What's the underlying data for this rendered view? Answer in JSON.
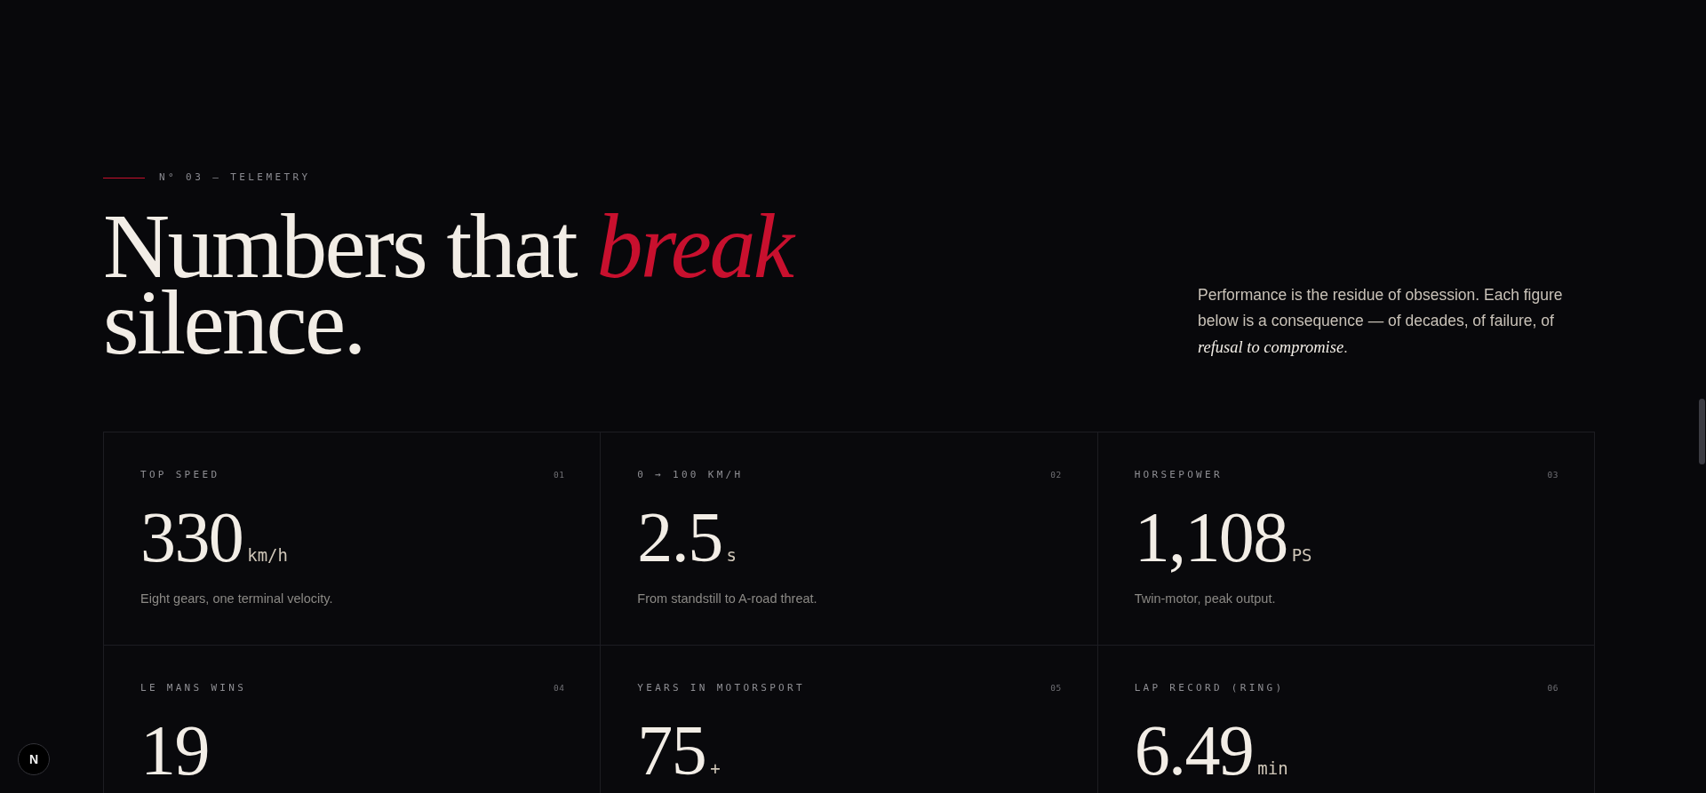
{
  "section": {
    "eyebrow": "N° 03 — TELEMETRY",
    "heading": "Numbers that *break* silence.",
    "intro": "Performance is the residue of obsession. Each figure below is a consequence — of decades, of failure, of *refusal to compromise*."
  },
  "stats": [
    {
      "label": "TOP SPEED",
      "index": "01",
      "value": "330",
      "unit": "km/h",
      "description": "Eight gears, one terminal velocity."
    },
    {
      "label": "0 → 100 KM/H",
      "index": "02",
      "value": "2.5",
      "unit": "s",
      "description": "From standstill to A-road threat."
    },
    {
      "label": "HORSEPOWER",
      "index": "03",
      "value": "1,108",
      "unit": "PS",
      "description": "Twin-motor, peak output."
    },
    {
      "label": "LE MANS WINS",
      "index": "04",
      "value": "19"
    },
    {
      "label": "YEARS IN MOTORSPORT",
      "index": "05",
      "value": "75",
      "unit": "+"
    },
    {
      "label": "LAP RECORD (RING)",
      "index": "06",
      "value": "6.49",
      "unit": "min"
    }
  ],
  "dev_badge": {
    "label": "N"
  }
}
